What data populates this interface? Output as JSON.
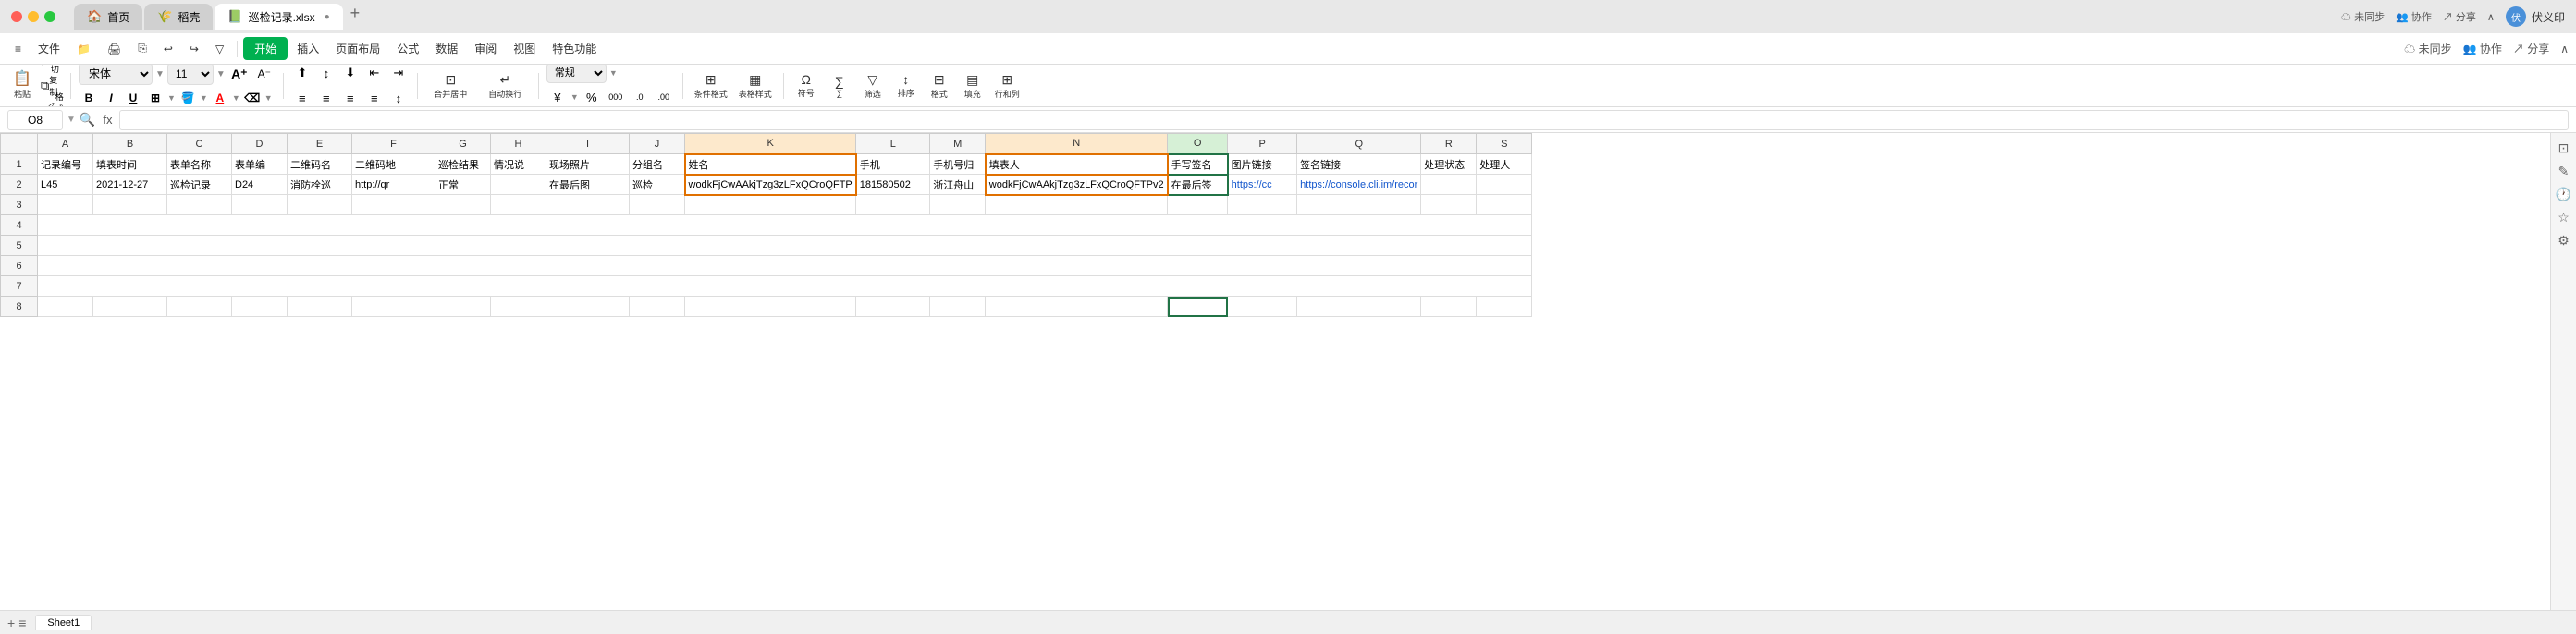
{
  "titlebar": {
    "traffic": [
      "red",
      "yellow",
      "green"
    ],
    "tabs": [
      {
        "label": "首页",
        "icon": "🏠",
        "active": true
      },
      {
        "label": "稻壳",
        "icon": "🌾",
        "active": false
      },
      {
        "label": "巡检记录.xlsx",
        "icon": "📗",
        "active": true,
        "close": "●"
      }
    ],
    "add_tab": "+",
    "user_name": "伏义印",
    "sync": "未同步",
    "collab": "协作",
    "share": "分享"
  },
  "menubar": {
    "items": [
      "≡ 文件",
      "📁",
      "🖨",
      "⎘",
      "↩",
      "↪",
      "▽",
      "开始",
      "插入",
      "页面布局",
      "公式",
      "数据",
      "审阅",
      "视图",
      "特色功能"
    ]
  },
  "toolbar": {
    "paste_label": "粘贴",
    "cut_label": "剪切",
    "copy_label": "复制",
    "format_painter_label": "格式刷",
    "font_family": "宋体",
    "font_size": "11",
    "bold": "B",
    "italic": "I",
    "underline": "U",
    "border": "⊞",
    "fill_color": "A",
    "font_color": "A",
    "eraser": "⌫",
    "align_left": "≡",
    "align_center": "≡",
    "align_right": "≡",
    "indent_dec": "⇤",
    "indent_inc": "⇥",
    "align_top": "⬆",
    "align_mid": "⬆",
    "align_bot": "⬇",
    "wrap": "↵",
    "merge_center": "合并居中",
    "auto_newline": "自动换行",
    "number_format": "常规",
    "yuan": "¥",
    "percent": "%",
    "thousands": "000",
    "dec_dec": ".00",
    "dec_inc": ".00",
    "conditional_format": "条件格式",
    "table_style": "表格样式",
    "symbol": "符号",
    "sum": "∑",
    "filter": "筛选",
    "sort": "排序",
    "format": "格式",
    "fill": "填充",
    "row_col": "行和列"
  },
  "formulabar": {
    "cell_ref": "O8",
    "formula_content": ""
  },
  "grid": {
    "col_headers": [
      "A",
      "B",
      "C",
      "D",
      "E",
      "F",
      "G",
      "H",
      "I",
      "J",
      "K",
      "L",
      "M",
      "N",
      "O",
      "P",
      "Q",
      "R",
      "S"
    ],
    "rows": [
      {
        "row_num": "1",
        "cells": [
          "记录编号",
          "填表时间",
          "表单名称",
          "表单编",
          "二维码名",
          "二维码地",
          "巡检结果",
          "情况说",
          "现场照片",
          "分组名",
          "姓名",
          "手机",
          "手机号归",
          "填表人",
          "手写签名",
          "图片链接",
          "签名链接",
          "处理状态",
          "处理人"
        ]
      },
      {
        "row_num": "2",
        "cells": [
          "L45",
          "2021-12-27",
          "巡检记录",
          "D24",
          "消防栓巡",
          "http://qr",
          "正常",
          "",
          "在最后图",
          "巡检",
          "wodkFjCwAAkjTzg3zLFxQCroQFTP",
          "181580502",
          "浙江舟山",
          "wodkFjCwAAkjTzg3zLFxQCroQFTPv2",
          "在最后签",
          "https://cc",
          "https://console.cli.im/recor",
          "",
          ""
        ]
      },
      {
        "row_num": "3",
        "cells": []
      },
      {
        "row_num": "4",
        "cells": []
      },
      {
        "row_num": "5",
        "cells": []
      },
      {
        "row_num": "6",
        "cells": []
      },
      {
        "row_num": "7",
        "cells": []
      },
      {
        "row_num": "8",
        "cells": []
      }
    ]
  },
  "sheet_tabs": [
    {
      "label": "Sheet1",
      "active": true
    }
  ],
  "icons": {
    "corner": "▲",
    "search": "🔍",
    "settings": "⚙",
    "eye": "👁",
    "magic": "✨"
  }
}
